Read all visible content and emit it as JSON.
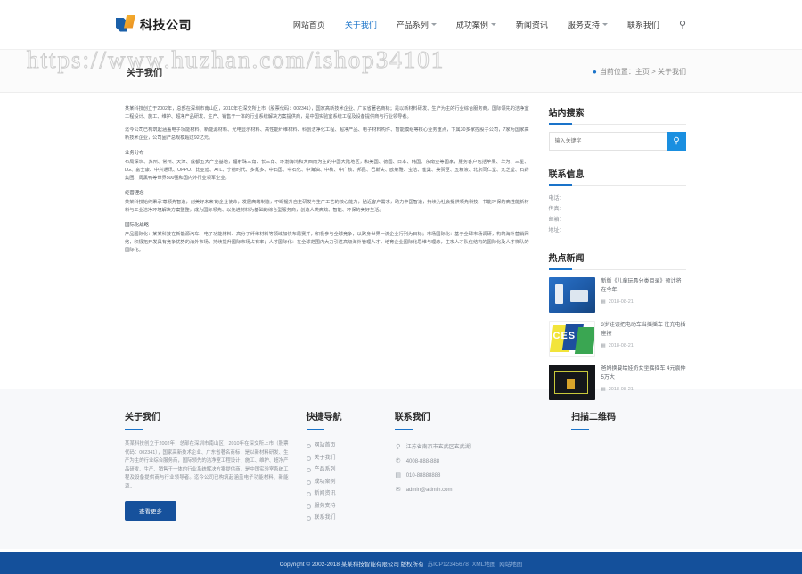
{
  "header": {
    "logo_text": "科技公司",
    "nav": [
      {
        "label": "网站首页",
        "active": false,
        "caret": false
      },
      {
        "label": "关于我们",
        "active": true,
        "caret": false
      },
      {
        "label": "产品系列",
        "active": false,
        "caret": true
      },
      {
        "label": "成功案例",
        "active": false,
        "caret": true
      },
      {
        "label": "新闻资讯",
        "active": false,
        "caret": false
      },
      {
        "label": "服务支持",
        "active": false,
        "caret": true
      },
      {
        "label": "联系我们",
        "active": false,
        "caret": false
      }
    ],
    "search_icon": "search-icon"
  },
  "banner": {
    "title": "关于我们",
    "breadcrumb": "当前位置：主页 > 关于我们"
  },
  "watermark": "https://www.huzhan.com/ishop34101",
  "article": {
    "p1": "某某科技创立于2002年，总部在深圳市南山区，2010年在深交所上市（股票代码：002341），国家高新技术企业、广东省著名商标；是以新材料研发、生产为主的行业综合服务商，国际领先的洁净室工程设计、施工、维护、超净产品研发、生产、销售于一体的行业系统解决方案提供商，是中国实验室系统工程及设备提供商与行业领导者。",
    "p2": "迄今公司已构筑起涵盖电子功能材料、新能源材料、光电显示材料、高性能纤维材料、科创洁净化工程、超净产品、电子材料构件、智能模组等核心业务重点，下属30多家控股子公司，7家为国家高新技术企业，公司固产总规模超过92亿元。",
    "h1": "业务分布",
    "p3": "布局深圳、苏州、常州、天津、成都五大产业基地，辐射珠三角、长三角、环渤海湾和大西南为主的中国大陆地区，和美国、德国、日本、韩国、东南亚等国家，服务客户包括苹果、华为、三星、LG、富士康、中兴通讯、OPPO、比亚迪、ATL、宁德时代、多氟多、中石国、中石化、中海油、中核、中广核、邦民、巴斯夫、欧莱雅、宝洁、雀巢、美赞臣、五粮液、北京同仁堂、九芝堂、石药集团、周黑鸭等世界500强和国内外行业领军企业。",
    "h2": "经营理念",
    "p4": "某某科技始终秉承'尊领先智造，创美好未来'的企业使命，发展高端制造，不断提升自主研发与生产工艺的核心能力，贴近客户需求，助力中国智造，持续为社会提供领先科技、节能环保的高性能新材料与工业洁净环境解决方案整整，成为国际领先、以先进材料为基础的综合型服务商，创造人类高效、智能、环保的美好生活。",
    "h3": "国际化战略",
    "p5": "产品国际化：某某科技在新能源汽车、电子功能材料、高分子纤维材料等领域加快布局赛并，积极参与全球竞争，以跻身世界一流企业行列为目标；市场国际化：基于全球市场调研，构筑海外营销网络，积极拓开发具有竞争优势的海外市场，持续提升国际市场占有率；人才国际化：在全球范围内大力引进高级海外管理人才，培育企业国际化思维与理念，主攻人才队伍结构的国际化及人才梯队的国际化。"
  },
  "sidebar": {
    "search": {
      "title": "站内搜索",
      "placeholder": "输入关键字",
      "button_icon": "search-icon"
    },
    "contact": {
      "title": "联系信息",
      "rows": [
        "电话：",
        "传真：",
        "邮箱：",
        "地址："
      ]
    },
    "news": {
      "title": "热点新闻",
      "items": [
        {
          "title": "新版《儿童玩具分类目录》预计将在今年",
          "date": "2018-08-21",
          "thumb": "nt1"
        },
        {
          "title": "3岁娃误把电动车当摇摇车 往充电插座按",
          "date": "2018-08-21",
          "thumb": "nt2"
        },
        {
          "title": "爸妈换要给娃奶女坐摇摇车 4元震仲5万大",
          "date": "2018-08-21",
          "thumb": "nt3"
        }
      ]
    }
  },
  "footer": {
    "about": {
      "title": "关于我们",
      "text": "某某科技创立于2002年，总部在深圳市南山区，2010年在深交所上市（股票代码：002341），国家高新技术企业、广东省著名商标；是以新材料研发、生产为主的行业综合服务商，国际领先的洁净室工程设计、施工、维护、超净产品研发、生产、销售于一体的行业系统解决方案提供商，是中国实验室系统工程及设备提供商与行业领导者。迄今公司已构筑起涵盖电子功能材料、新能源..",
      "button": "查看更多"
    },
    "quicknav": {
      "title": "快捷导航",
      "links": [
        "网站首页",
        "关于我们",
        "产品系列",
        "成功案例",
        "新闻资讯",
        "服务支持",
        "联系我们"
      ]
    },
    "contact": {
      "title": "联系我们",
      "rows": [
        {
          "icon": "location-icon",
          "glyph": "⚲",
          "text": "江苏省南京市玄武区玄武湖"
        },
        {
          "icon": "phone-icon",
          "glyph": "✆",
          "text": "4008-888-888"
        },
        {
          "icon": "fax-icon",
          "glyph": "▤",
          "text": "010-88888888"
        },
        {
          "icon": "email-icon",
          "glyph": "✉",
          "text": "admin@admin.com"
        }
      ]
    },
    "qr": {
      "title": "扫描二维码"
    }
  },
  "copyright": {
    "main": "Copyright © 2002-2018 某某科技智能有限公司 版权所有",
    "icp": "苏ICP12345678",
    "xml": "XML地图",
    "sitemap": "网站地图"
  },
  "colors": {
    "brand_blue": "#14509b",
    "link_blue": "#1a73c9",
    "search_blue": "#1a8fe0"
  }
}
